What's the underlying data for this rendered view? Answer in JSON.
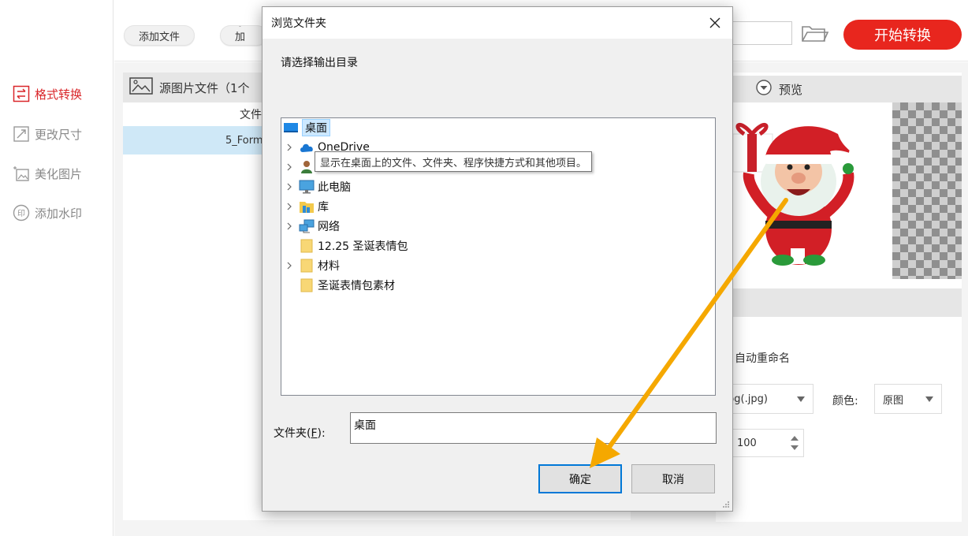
{
  "sidebar": {
    "items": [
      {
        "label": "格式转换",
        "icon": "swap-icon",
        "active": true
      },
      {
        "label": "更改尺寸",
        "icon": "resize-icon",
        "active": false
      },
      {
        "label": "美化图片",
        "icon": "beautify-icon",
        "active": false
      },
      {
        "label": "添加水印",
        "icon": "watermark-icon",
        "active": false
      }
    ]
  },
  "toolbar": {
    "add_file_label": "添加文件",
    "add_folder_label": "添加文",
    "start_label": "开始转换"
  },
  "file_panel": {
    "title": "源图片文件（1个",
    "column_header": "文件",
    "rows": [
      {
        "name": "5_Form"
      }
    ]
  },
  "preview": {
    "title": "预览",
    "auto_rename_label": "自动重命名",
    "format_value": "pg(.jpg)",
    "color_label": "颜色:",
    "color_value": "原图",
    "quality_value": "100"
  },
  "dialog": {
    "title": "浏览文件夹",
    "prompt": "请选择输出目录",
    "tooltip": "显示在桌面上的文件、文件夹、程序快捷方式和其他项目。",
    "tree": [
      {
        "label": "桌面",
        "icon": "desktop-icon",
        "expandable": false,
        "selected": true
      },
      {
        "label": "OneDrive",
        "icon": "cloud-icon",
        "expandable": true
      },
      {
        "label": "",
        "icon": "user-icon",
        "expandable": true
      },
      {
        "label": "此电脑",
        "icon": "computer-icon",
        "expandable": true
      },
      {
        "label": "库",
        "icon": "library-icon",
        "expandable": true
      },
      {
        "label": "网络",
        "icon": "network-icon",
        "expandable": true
      },
      {
        "label": "12.25 圣诞表情包",
        "icon": "folder-icon",
        "expandable": false
      },
      {
        "label": "材料",
        "icon": "folder-icon",
        "expandable": true
      },
      {
        "label": "圣诞表情包素材",
        "icon": "folder-icon",
        "expandable": false
      }
    ],
    "folder_label_prefix": "文件夹(",
    "folder_label_key": "F",
    "folder_label_suffix": "):",
    "folder_value": "桌面",
    "ok_label": "确定",
    "cancel_label": "取消"
  },
  "colors": {
    "accent_red": "#e8261e",
    "selection_blue": "#cce8ff",
    "annotation_arrow": "#f5a800"
  }
}
